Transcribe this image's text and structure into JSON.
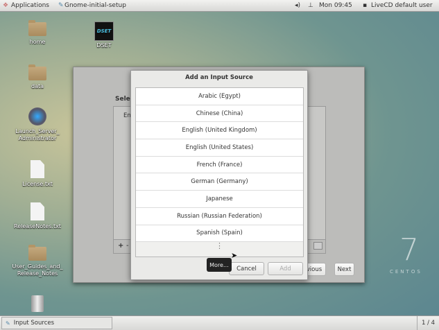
{
  "topbar": {
    "applications": "Applications",
    "window_title": "Gnome-initial-setup",
    "clock": "Mon 09:45",
    "user": "LiveCD default user"
  },
  "desktop": {
    "icons": [
      "home",
      "DSET",
      "data",
      "Launch_Server_\nAdministrator",
      "License.txt",
      "ReleaseNotes.txt",
      "User_Guides_and_\nRelease_Notes"
    ],
    "dset_logo": "DSET"
  },
  "background_window": {
    "label": "Selec",
    "list_item": "En",
    "previous": "vious",
    "next": "Next",
    "add": "+",
    "remove": "-"
  },
  "dialog": {
    "title": "Add an Input Source",
    "items": [
      "Arabic (Egypt)",
      "Chinese (China)",
      "English (United Kingdom)",
      "English (United States)",
      "French (France)",
      "German (Germany)",
      "Japanese",
      "Russian (Russian Federation)",
      "Spanish (Spain)"
    ],
    "more_tooltip": "More…",
    "cancel": "Cancel",
    "add": "Add"
  },
  "branding": {
    "version": "7",
    "name": "CENTOS"
  },
  "taskbar": {
    "item": "Input Sources",
    "workspace": "1 / 4"
  }
}
